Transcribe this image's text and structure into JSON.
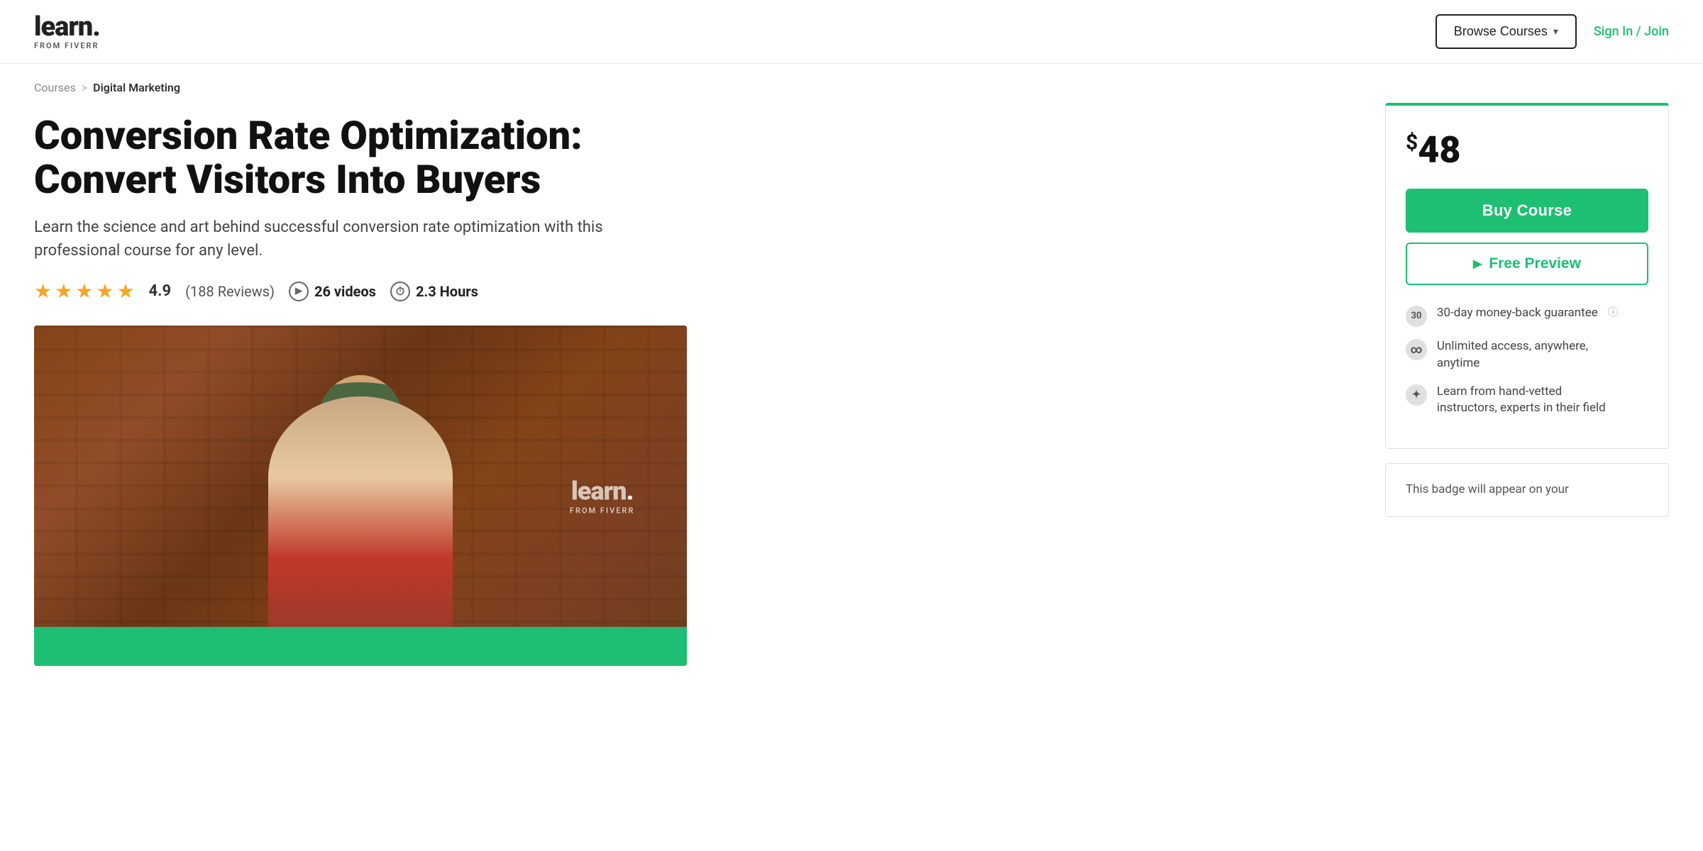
{
  "nav": {
    "logo_learn": "learn.",
    "logo_sub": "FROM FIVERR",
    "browse_label": "Browse Courses",
    "signin_label": "Sign In / Join"
  },
  "breadcrumb": {
    "parent": "Courses",
    "separator": ">",
    "current": "Digital Marketing"
  },
  "course": {
    "title": "Conversion Rate Optimization: Convert Visitors Into Buyers",
    "description": "Learn the science and art behind successful conversion rate optimization with this professional course for any level.",
    "rating_value": "4.9",
    "rating_count": "(188 Reviews)",
    "videos_label": "26 videos",
    "hours_label": "2.3 Hours"
  },
  "sidebar": {
    "price": "$48",
    "buy_label": "Buy Course",
    "preview_label": "Free Preview",
    "feature_1": "30-day money-back guarantee",
    "feature_2_line1": "Unlimited access, anywhere,",
    "feature_2_line2": "anytime",
    "feature_3_line1": "Learn from hand-vetted",
    "feature_3_line2": "instructors, experts in their field"
  },
  "badge_card": {
    "text": "This badge will appear on your"
  },
  "thumbnail": {
    "logo_learn": "learn.",
    "logo_sub": "FROM FIVERR"
  },
  "icons": {
    "chevron": "▾",
    "play": "▶",
    "thirty": "30",
    "infinity": "∞",
    "pin": "🖈"
  }
}
